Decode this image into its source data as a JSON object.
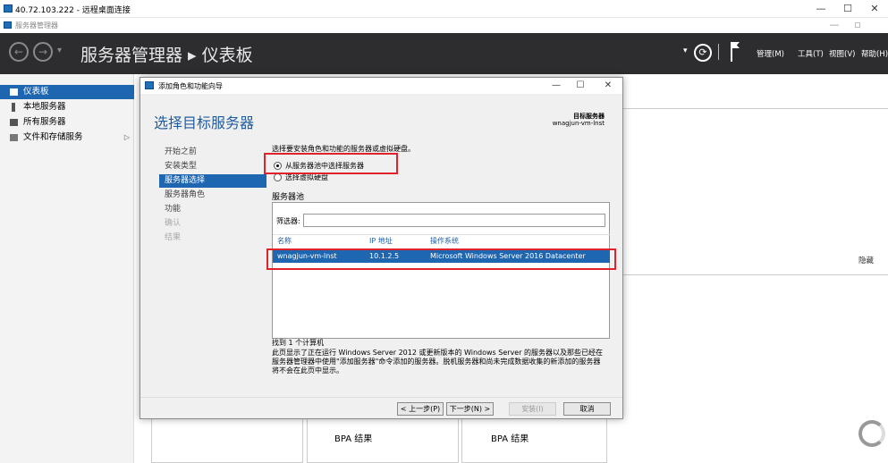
{
  "rdp_window": {
    "title": "40.72.103.222 - 远程桌面连接",
    "minimize": "—",
    "maximize": "☐",
    "close": "✕"
  },
  "app_window": {
    "title": "服务器管理器",
    "minimize": "—",
    "restore": "▫"
  },
  "header": {
    "breadcrumb": "服务器管理器 ▸ 仪表板",
    "back": "←",
    "forward": "→",
    "history": "▾",
    "refresh": "⟳",
    "menus": [
      "管理(M)",
      "工具(T)",
      "视图(V)",
      "帮助(H)"
    ]
  },
  "sidebar": {
    "items": [
      {
        "label": "仪表板",
        "active": true
      },
      {
        "label": "本地服务器",
        "active": false
      },
      {
        "label": "所有服务器",
        "active": false
      },
      {
        "label": "文件和存储服务",
        "active": false,
        "chevron": "▷"
      }
    ]
  },
  "dashboard": {
    "hide": "隐藏",
    "tiles": [
      {
        "bpa": "BPA 结果"
      },
      {
        "bpa": "BPA 结果"
      }
    ]
  },
  "dialog": {
    "title": "添加角色和功能向导",
    "minimize": "—",
    "maximize": "☐",
    "close": "✕",
    "heading": "选择目标服务器",
    "target_label": "目标服务器",
    "target_value": "wnagjun-vm-lnst",
    "steps": [
      {
        "label": "开始之前",
        "state": "normal"
      },
      {
        "label": "安装类型",
        "state": "normal"
      },
      {
        "label": "服务器选择",
        "state": "active"
      },
      {
        "label": "服务器角色",
        "state": "normal"
      },
      {
        "label": "功能",
        "state": "normal"
      },
      {
        "label": "确认",
        "state": "disabled"
      },
      {
        "label": "结果",
        "state": "disabled"
      }
    ],
    "instruction": "选择要安装角色和功能的服务器或虚拟硬盘。",
    "radio_pool": "从服务器池中选择服务器",
    "radio_vhd": "选择虚拟硬盘",
    "pool_title": "服务器池",
    "filter_label": "筛选器:",
    "filter_value": "",
    "columns": [
      "名称",
      "IP 地址",
      "操作系统"
    ],
    "rows": [
      {
        "name": "wnagjun-vm-lnst",
        "ip": "10.1.2.5",
        "os": "Microsoft Windows Server 2016 Datacenter"
      }
    ],
    "found": "找到 1 个计算机",
    "description_lines": [
      "此页显示了正在运行 Windows Server 2012 或更新版本的 Windows Server 的服务器以及那些已经在",
      "服务器管理器中使用\"添加服务器\"命令添加的服务器。脱机服务器和尚未完成数据收集的新添加的服务器",
      "将不会在此页中显示。"
    ],
    "buttons": {
      "prev": "< 上一步(P)",
      "next": "下一步(N) >",
      "install": "安装(I)",
      "cancel": "取消"
    }
  },
  "colors": {
    "accent": "#1f66b0",
    "header_bg": "#2d2d30",
    "highlight_border": "#e0222a"
  }
}
